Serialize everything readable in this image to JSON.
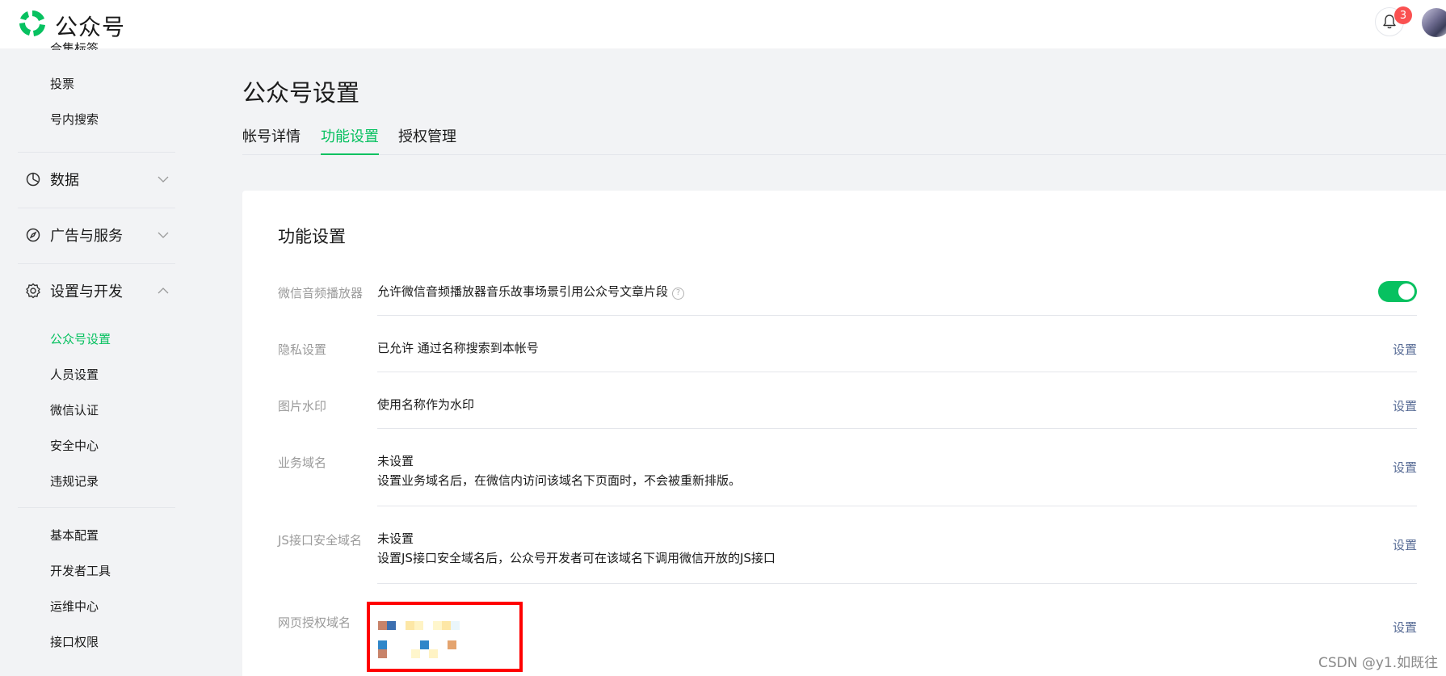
{
  "app": {
    "brand": "公众号"
  },
  "header": {
    "notification_count": "3"
  },
  "sidebar": {
    "clipped_item": "合集标签",
    "items_top": [
      "投票",
      "号内搜索"
    ],
    "groups": [
      {
        "label": "数据",
        "icon": "pie-chart-icon",
        "expanded": false
      },
      {
        "label": "广告与服务",
        "icon": "compass-icon",
        "expanded": false
      },
      {
        "label": "设置与开发",
        "icon": "gear-icon",
        "expanded": true
      }
    ],
    "settings_items": [
      "公众号设置",
      "人员设置",
      "微信认证",
      "安全中心",
      "违规记录"
    ],
    "dev_items": [
      "基本配置",
      "开发者工具",
      "运维中心",
      "接口权限"
    ],
    "active_item": "公众号设置"
  },
  "main": {
    "title": "公众号设置",
    "tabs": [
      {
        "label": "帐号详情",
        "active": false
      },
      {
        "label": "功能设置",
        "active": true
      },
      {
        "label": "授权管理",
        "active": false
      }
    ],
    "card_title": "功能设置",
    "rows": [
      {
        "label": "微信音频播放器",
        "value": "允许微信音频播放器音乐故事场景引用公众号文章片段",
        "toggle_on": true
      },
      {
        "label": "隐私设置",
        "value": "已允许 通过名称搜索到本帐号",
        "action": "设置"
      },
      {
        "label": "图片水印",
        "value": "使用名称作为水印",
        "action": "设置"
      },
      {
        "label": "业务域名",
        "value": "未设置",
        "desc": "设置业务域名后，在微信内访问该域名下页面时，不会被重新排版。",
        "action": "设置"
      },
      {
        "label": "JS接口安全域名",
        "value": "未设置",
        "desc": "设置JS接口安全域名后，公众号开发者可在该域名下调用微信开放的JS接口",
        "action": "设置"
      },
      {
        "label": "网页授权域名",
        "action": "设置"
      }
    ]
  },
  "colors": {
    "accent": "#07c160",
    "link": "#576b95",
    "badge": "#fa5151",
    "highlight_box": "#ff0000"
  },
  "watermark": "CSDN @y1.如既往"
}
